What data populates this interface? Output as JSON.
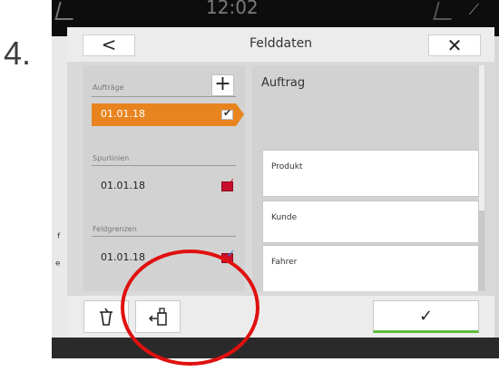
{
  "step_number": "4.",
  "status_bar": {
    "time": "12:02"
  },
  "dialog": {
    "title": "Felddaten",
    "back_label": "<",
    "close_label": "✕"
  },
  "left_panel": {
    "sections": [
      {
        "title": "Aufträge",
        "add_label": "+",
        "items": [
          {
            "date": "01.01.18",
            "selected": true,
            "checked": true
          }
        ]
      },
      {
        "title": "Spurlinien",
        "items": [
          {
            "date": "01.01.18",
            "selected": false,
            "checked": true,
            "color": "#d0021b"
          }
        ]
      },
      {
        "title": "Feldgrenzen",
        "items": [
          {
            "date": "01.01.18",
            "selected": false,
            "checked": true,
            "color": "#2b7bd9"
          }
        ]
      }
    ]
  },
  "right_panel": {
    "title": "Auftrag",
    "fields": [
      {
        "label": "Produkt",
        "value": ""
      },
      {
        "label": "Kunde",
        "value": ""
      },
      {
        "label": "Fahrer",
        "value": ""
      }
    ]
  },
  "bottom_bar": {
    "delete_icon": "trash-icon",
    "export_icon": "usb-export-icon",
    "confirm_label": "✓"
  },
  "colors": {
    "accent": "#e8841f",
    "confirm_underline": "#5dbb3c",
    "annotation_circle": "#e01010"
  }
}
